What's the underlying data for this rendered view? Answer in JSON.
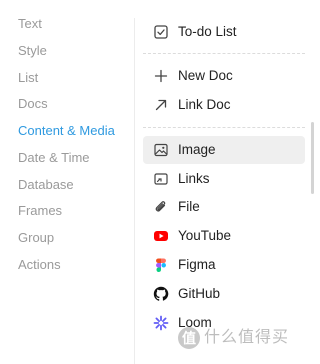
{
  "categories": [
    {
      "label": "Text"
    },
    {
      "label": "Style"
    },
    {
      "label": "List"
    },
    {
      "label": "Docs"
    },
    {
      "label": "Content & Media"
    },
    {
      "label": "Date & Time"
    },
    {
      "label": "Database"
    },
    {
      "label": "Frames"
    },
    {
      "label": "Group"
    },
    {
      "label": "Actions"
    }
  ],
  "active_category": "Content & Media",
  "items": [
    {
      "label": "To-do List",
      "icon": "checkbox-icon"
    },
    {
      "label": "New Doc",
      "icon": "plus-icon"
    },
    {
      "label": "Link Doc",
      "icon": "arrow-up-right-icon"
    },
    {
      "label": "Image",
      "icon": "image-icon"
    },
    {
      "label": "Links",
      "icon": "link-card-icon"
    },
    {
      "label": "File",
      "icon": "paperclip-icon"
    },
    {
      "label": "YouTube",
      "icon": "youtube-icon"
    },
    {
      "label": "Figma",
      "icon": "figma-icon"
    },
    {
      "label": "GitHub",
      "icon": "github-icon"
    },
    {
      "label": "Loom",
      "icon": "loom-icon"
    }
  ],
  "selected_item": "Image",
  "watermark": {
    "badge": "值",
    "text": "什么值得买"
  },
  "colors": {
    "accent": "#2f9ae0",
    "muted_text": "#9a9a9a",
    "selected_bg": "#efefef",
    "youtube_red": "#ff0000"
  }
}
